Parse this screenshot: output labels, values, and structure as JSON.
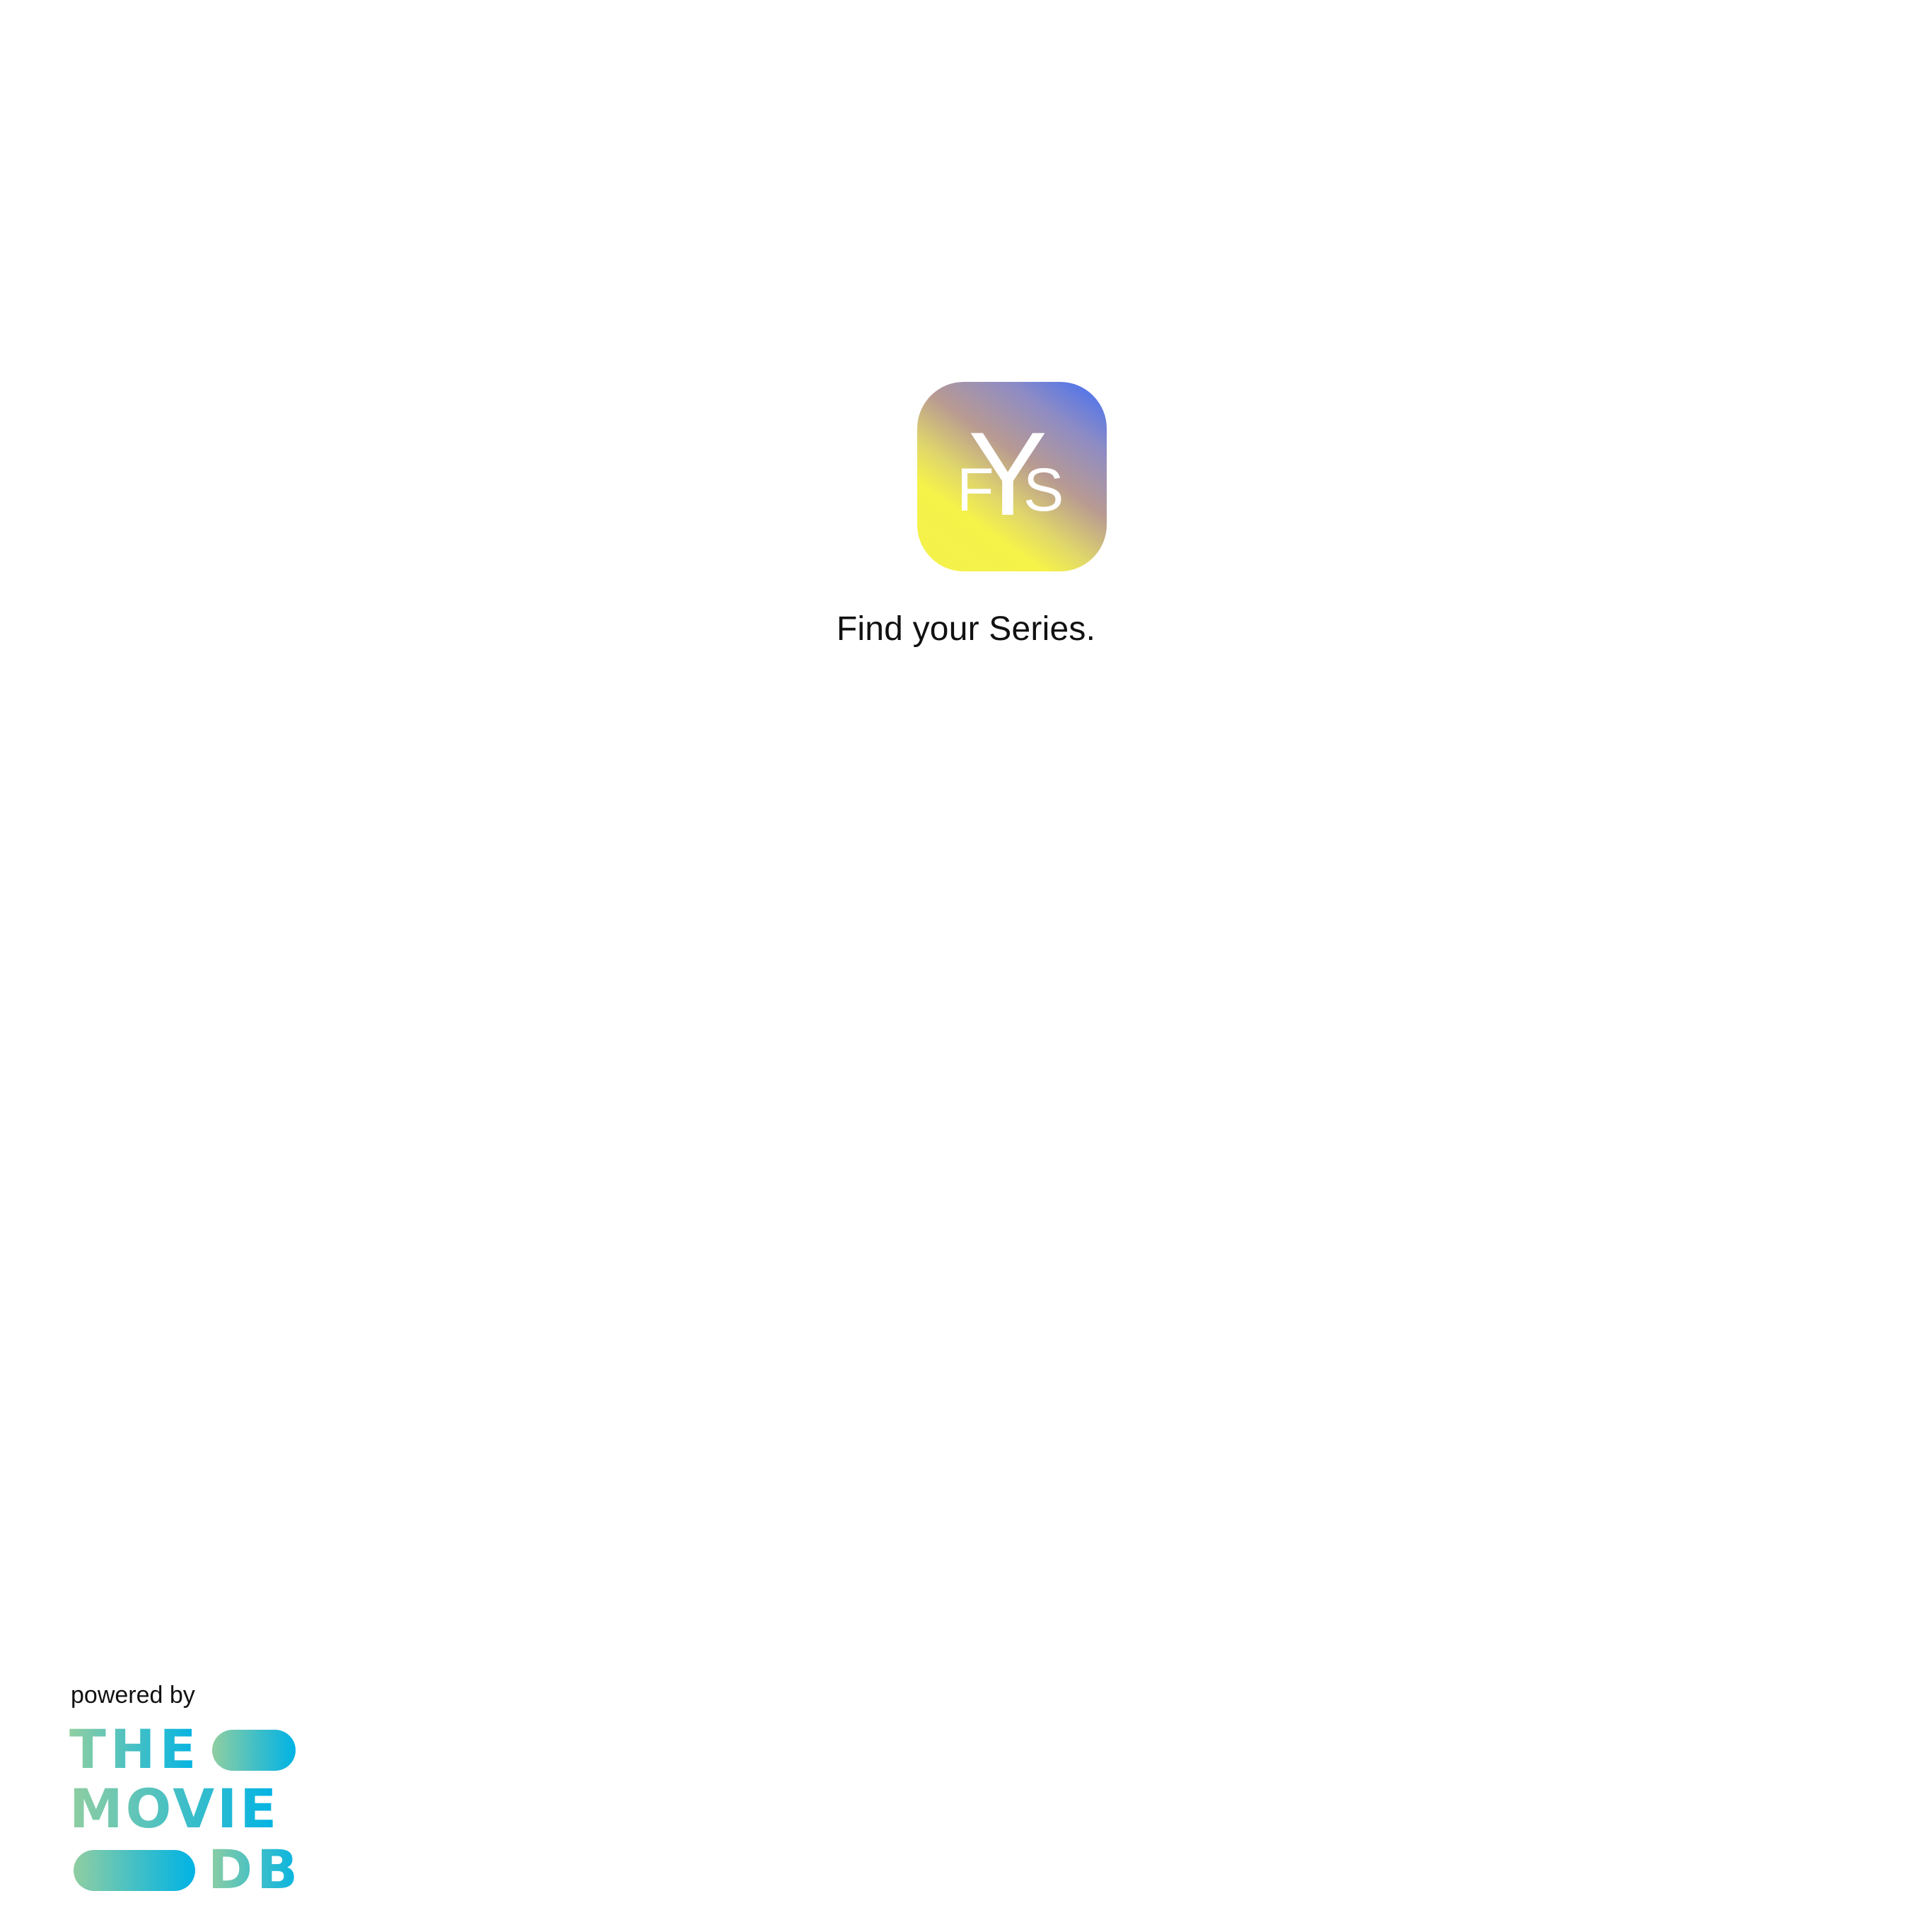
{
  "app": {
    "icon_name": "fys-app-icon",
    "icon_letters": {
      "f": "F",
      "y": "Y",
      "s": "S"
    },
    "tagline": "Find your Series."
  },
  "footer": {
    "powered_by": "powered by",
    "logo_name": "tmdb-logo",
    "logo_text": {
      "line1": "THE",
      "line2": "MOVIE",
      "line3": "DB"
    }
  },
  "colors": {
    "background": "#ffffff",
    "text": "#111111",
    "icon_gradient_start": "#3f6ef5",
    "icon_gradient_end": "#f5f24a",
    "tmdb_green": "#90cea1",
    "tmdb_blue": "#01b4e4"
  }
}
